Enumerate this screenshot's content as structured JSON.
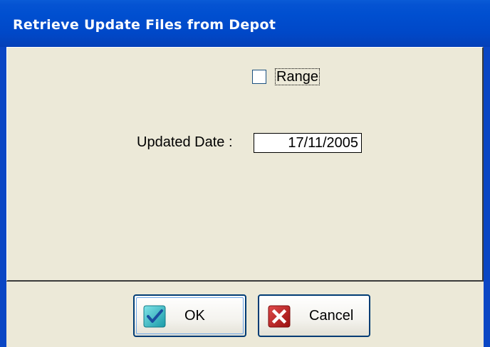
{
  "window": {
    "title": "Retrieve Update Files from Depot",
    "accent_color": "#0054e3"
  },
  "range": {
    "label": "Range",
    "checked": false
  },
  "updated_date": {
    "label": "Updated Date :",
    "value": "17/11/2005"
  },
  "buttons": {
    "ok_label": "OK",
    "cancel_label": "Cancel",
    "ok_icon": "checkmark-icon",
    "cancel_icon": "x-icon"
  }
}
